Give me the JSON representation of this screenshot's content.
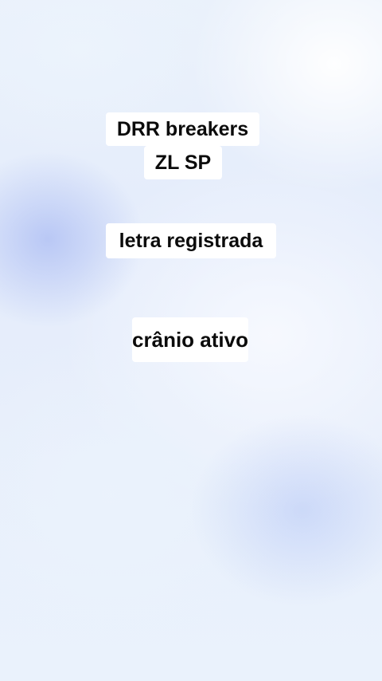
{
  "captions": [
    {
      "lines": [
        "DRR breakers",
        "ZL SP"
      ]
    },
    {
      "text": "letra registrada"
    },
    {
      "text": "crânio ativo"
    }
  ],
  "colors": {
    "caption_background": "#ffffff",
    "caption_text": "#0b0b0b",
    "background_base": "#e6edfb"
  }
}
